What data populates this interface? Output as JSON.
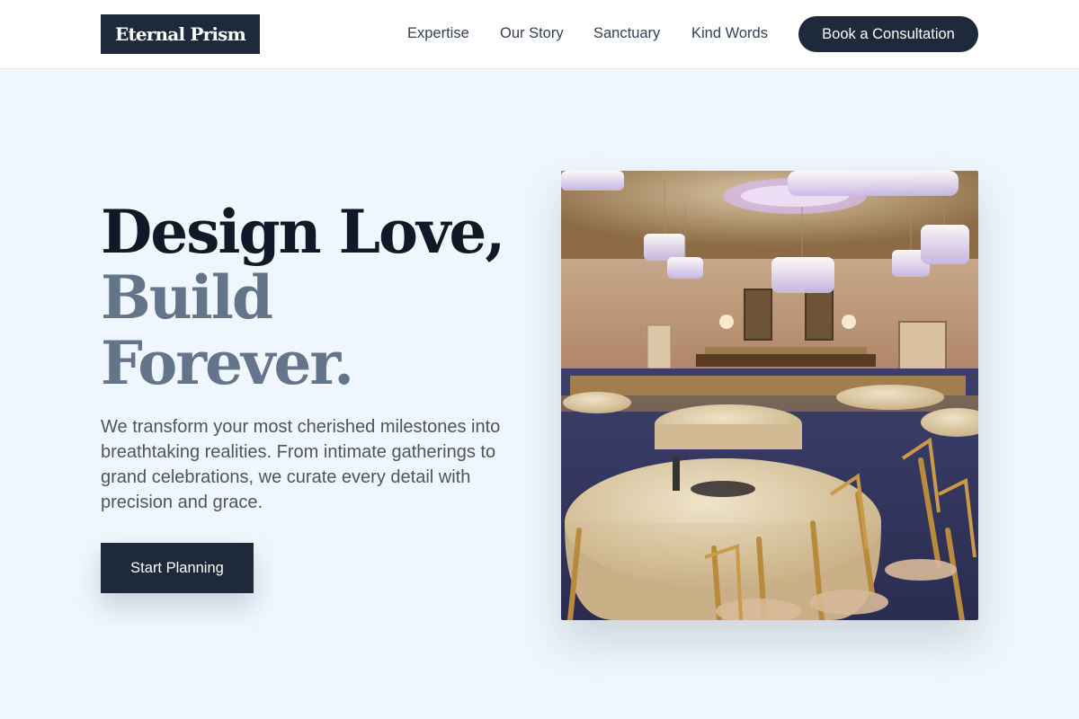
{
  "brand": {
    "name": "Eternal Prism"
  },
  "nav": {
    "links": [
      "Expertise",
      "Our Story",
      "Sanctuary",
      "Kind Words"
    ],
    "cta_label": "Book a Consultation"
  },
  "hero": {
    "headline_line1": "Design Love,",
    "headline_line2": "Build",
    "headline_line3": "Forever.",
    "description": "We transform your most cherished milestones into breathtaking realities. From intimate gatherings to grand celebrations, we curate every detail with precision and grace.",
    "button_label": "Start Planning"
  },
  "colors": {
    "brand_dark": "#1e293b",
    "accent_slate": "#64748b",
    "page_background": "#eff6fd"
  },
  "icons": {
    "hero_image": "banquet-hall-photo"
  }
}
